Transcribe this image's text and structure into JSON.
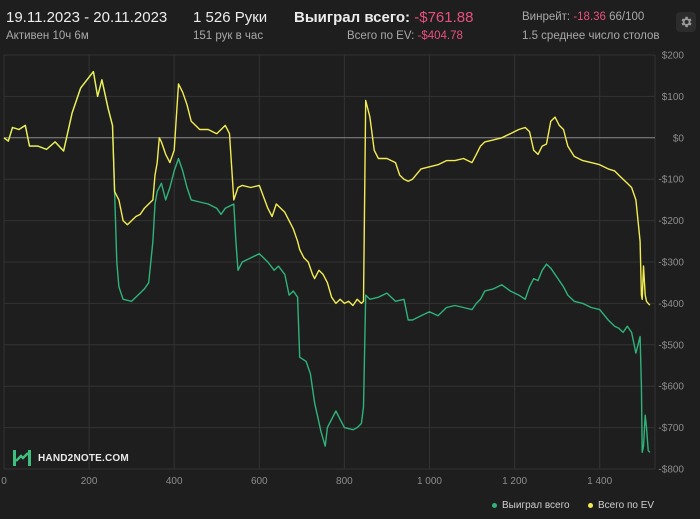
{
  "header": {
    "date_range": "19.11.2023 - 20.11.2023",
    "active": "Активен 10ч 6м",
    "hands": "1 526 Руки",
    "hands_per_hour": "151 рук в час",
    "won_total_label": "Выиграл всего:",
    "won_total_value": "-$761.88",
    "ev_total_label": "Всего по EV:",
    "ev_total_value": "-$404.78",
    "winrate_label": "Винрейт:",
    "winrate_value": "-18.36",
    "winrate_unit": "66/100",
    "avg_tables": "1.5 среднее число столов"
  },
  "logo": {
    "text": "HAND2NOTE.COM"
  },
  "settings": {
    "icon": "gear-icon"
  },
  "colors": {
    "background": "#1e1e1e",
    "won": "#2fb37a",
    "ev": "#f2ec52",
    "negative": "#e8507e",
    "grid": "#333333"
  },
  "chart_data": {
    "type": "line",
    "x_ticks": [
      "0",
      "200",
      "400",
      "600",
      "800",
      "1 000",
      "1 200",
      "1 400"
    ],
    "y_ticks": [
      "$200",
      "$100",
      "$0",
      "-$100",
      "-$200",
      "-$300",
      "-$400",
      "-$500",
      "-$600",
      "-$700",
      "-$800"
    ],
    "xlim": [
      0,
      1530
    ],
    "ylim": [
      -800,
      200
    ],
    "legend_position": "bottom-right",
    "series": [
      {
        "name": "Выиграл всего",
        "color": "#2fb37a",
        "points": [
          [
            0,
            0
          ],
          [
            10,
            -8
          ],
          [
            20,
            25
          ],
          [
            35,
            20
          ],
          [
            50,
            30
          ],
          [
            60,
            -20
          ],
          [
            80,
            -20
          ],
          [
            100,
            -28
          ],
          [
            120,
            -10
          ],
          [
            140,
            -32
          ],
          [
            160,
            60
          ],
          [
            180,
            120
          ],
          [
            195,
            140
          ],
          [
            210,
            160
          ],
          [
            220,
            100
          ],
          [
            230,
            140
          ],
          [
            245,
            70
          ],
          [
            255,
            30
          ],
          [
            260,
            -130
          ],
          [
            265,
            -300
          ],
          [
            270,
            -360
          ],
          [
            280,
            -390
          ],
          [
            300,
            -395
          ],
          [
            315,
            -380
          ],
          [
            330,
            -365
          ],
          [
            340,
            -350
          ],
          [
            345,
            -300
          ],
          [
            350,
            -250
          ],
          [
            355,
            -160
          ],
          [
            360,
            -130
          ],
          [
            370,
            -110
          ],
          [
            380,
            -150
          ],
          [
            390,
            -120
          ],
          [
            400,
            -80
          ],
          [
            410,
            -50
          ],
          [
            420,
            -80
          ],
          [
            430,
            -120
          ],
          [
            440,
            -150
          ],
          [
            460,
            -155
          ],
          [
            480,
            -160
          ],
          [
            500,
            -170
          ],
          [
            510,
            -185
          ],
          [
            520,
            -170
          ],
          [
            540,
            -160
          ],
          [
            545,
            -250
          ],
          [
            550,
            -320
          ],
          [
            560,
            -300
          ],
          [
            580,
            -290
          ],
          [
            600,
            -280
          ],
          [
            620,
            -300
          ],
          [
            635,
            -320
          ],
          [
            645,
            -310
          ],
          [
            660,
            -330
          ],
          [
            670,
            -380
          ],
          [
            680,
            -370
          ],
          [
            690,
            -385
          ],
          [
            695,
            -530
          ],
          [
            710,
            -540
          ],
          [
            720,
            -570
          ],
          [
            730,
            -640
          ],
          [
            745,
            -710
          ],
          [
            755,
            -745
          ],
          [
            760,
            -700
          ],
          [
            780,
            -660
          ],
          [
            790,
            -680
          ],
          [
            800,
            -700
          ],
          [
            820,
            -705
          ],
          [
            830,
            -700
          ],
          [
            840,
            -690
          ],
          [
            845,
            -650
          ],
          [
            850,
            -380
          ],
          [
            860,
            -390
          ],
          [
            880,
            -385
          ],
          [
            900,
            -375
          ],
          [
            920,
            -395
          ],
          [
            940,
            -390
          ],
          [
            950,
            -440
          ],
          [
            960,
            -440
          ],
          [
            980,
            -430
          ],
          [
            1000,
            -420
          ],
          [
            1020,
            -430
          ],
          [
            1040,
            -410
          ],
          [
            1060,
            -405
          ],
          [
            1080,
            -410
          ],
          [
            1100,
            -415
          ],
          [
            1110,
            -400
          ],
          [
            1120,
            -390
          ],
          [
            1130,
            -370
          ],
          [
            1150,
            -365
          ],
          [
            1170,
            -355
          ],
          [
            1190,
            -370
          ],
          [
            1210,
            -380
          ],
          [
            1225,
            -390
          ],
          [
            1235,
            -360
          ],
          [
            1245,
            -340
          ],
          [
            1255,
            -345
          ],
          [
            1265,
            -320
          ],
          [
            1275,
            -305
          ],
          [
            1285,
            -315
          ],
          [
            1295,
            -330
          ],
          [
            1305,
            -345
          ],
          [
            1315,
            -360
          ],
          [
            1325,
            -380
          ],
          [
            1340,
            -395
          ],
          [
            1360,
            -400
          ],
          [
            1380,
            -410
          ],
          [
            1400,
            -415
          ],
          [
            1420,
            -440
          ],
          [
            1435,
            -455
          ],
          [
            1445,
            -460
          ],
          [
            1455,
            -470
          ],
          [
            1465,
            -455
          ],
          [
            1475,
            -470
          ],
          [
            1485,
            -520
          ],
          [
            1490,
            -500
          ],
          [
            1495,
            -480
          ],
          [
            1498,
            -600
          ],
          [
            1500,
            -760
          ],
          [
            1503,
            -745
          ],
          [
            1507,
            -670
          ],
          [
            1510,
            -700
          ],
          [
            1514,
            -755
          ],
          [
            1518,
            -760
          ]
        ]
      },
      {
        "name": "Всего по EV",
        "color": "#f2ec52",
        "points": [
          [
            0,
            0
          ],
          [
            10,
            -8
          ],
          [
            20,
            25
          ],
          [
            35,
            20
          ],
          [
            50,
            30
          ],
          [
            60,
            -20
          ],
          [
            80,
            -20
          ],
          [
            100,
            -28
          ],
          [
            120,
            -10
          ],
          [
            140,
            -32
          ],
          [
            160,
            60
          ],
          [
            180,
            120
          ],
          [
            195,
            140
          ],
          [
            210,
            160
          ],
          [
            220,
            100
          ],
          [
            230,
            140
          ],
          [
            245,
            70
          ],
          [
            255,
            30
          ],
          [
            260,
            -130
          ],
          [
            270,
            -150
          ],
          [
            280,
            -200
          ],
          [
            290,
            -210
          ],
          [
            300,
            -200
          ],
          [
            310,
            -190
          ],
          [
            320,
            -185
          ],
          [
            330,
            -170
          ],
          [
            340,
            -160
          ],
          [
            350,
            -150
          ],
          [
            355,
            -90
          ],
          [
            360,
            -60
          ],
          [
            365,
            0
          ],
          [
            370,
            -10
          ],
          [
            380,
            -40
          ],
          [
            390,
            -60
          ],
          [
            400,
            -30
          ],
          [
            410,
            130
          ],
          [
            420,
            110
          ],
          [
            430,
            80
          ],
          [
            440,
            40
          ],
          [
            450,
            30
          ],
          [
            460,
            20
          ],
          [
            480,
            20
          ],
          [
            500,
            10
          ],
          [
            520,
            30
          ],
          [
            530,
            10
          ],
          [
            540,
            -150
          ],
          [
            550,
            -120
          ],
          [
            560,
            -115
          ],
          [
            580,
            -120
          ],
          [
            600,
            -115
          ],
          [
            620,
            -170
          ],
          [
            630,
            -190
          ],
          [
            640,
            -160
          ],
          [
            660,
            -180
          ],
          [
            680,
            -220
          ],
          [
            690,
            -250
          ],
          [
            695,
            -270
          ],
          [
            705,
            -290
          ],
          [
            715,
            -300
          ],
          [
            725,
            -330
          ],
          [
            730,
            -340
          ],
          [
            740,
            -320
          ],
          [
            750,
            -330
          ],
          [
            760,
            -350
          ],
          [
            770,
            -385
          ],
          [
            780,
            -400
          ],
          [
            790,
            -390
          ],
          [
            800,
            -400
          ],
          [
            810,
            -395
          ],
          [
            820,
            -405
          ],
          [
            830,
            -390
          ],
          [
            840,
            -400
          ],
          [
            845,
            -395
          ],
          [
            850,
            90
          ],
          [
            860,
            50
          ],
          [
            870,
            -30
          ],
          [
            880,
            -50
          ],
          [
            900,
            -50
          ],
          [
            920,
            -60
          ],
          [
            930,
            -90
          ],
          [
            940,
            -100
          ],
          [
            950,
            -105
          ],
          [
            960,
            -100
          ],
          [
            980,
            -75
          ],
          [
            1000,
            -70
          ],
          [
            1020,
            -65
          ],
          [
            1040,
            -55
          ],
          [
            1060,
            -55
          ],
          [
            1080,
            -50
          ],
          [
            1100,
            -60
          ],
          [
            1110,
            -40
          ],
          [
            1120,
            -20
          ],
          [
            1130,
            -10
          ],
          [
            1150,
            -5
          ],
          [
            1170,
            0
          ],
          [
            1190,
            10
          ],
          [
            1210,
            20
          ],
          [
            1225,
            25
          ],
          [
            1235,
            15
          ],
          [
            1245,
            -30
          ],
          [
            1255,
            -40
          ],
          [
            1265,
            -20
          ],
          [
            1275,
            -15
          ],
          [
            1285,
            40
          ],
          [
            1295,
            50
          ],
          [
            1305,
            30
          ],
          [
            1315,
            20
          ],
          [
            1325,
            -20
          ],
          [
            1340,
            -45
          ],
          [
            1360,
            -55
          ],
          [
            1380,
            -60
          ],
          [
            1400,
            -65
          ],
          [
            1420,
            -75
          ],
          [
            1435,
            -80
          ],
          [
            1445,
            -90
          ],
          [
            1455,
            -100
          ],
          [
            1465,
            -110
          ],
          [
            1475,
            -120
          ],
          [
            1485,
            -150
          ],
          [
            1490,
            -200
          ],
          [
            1495,
            -250
          ],
          [
            1498,
            -380
          ],
          [
            1500,
            -390
          ],
          [
            1503,
            -310
          ],
          [
            1507,
            -380
          ],
          [
            1510,
            -395
          ],
          [
            1514,
            -400
          ],
          [
            1518,
            -404
          ]
        ]
      }
    ]
  }
}
